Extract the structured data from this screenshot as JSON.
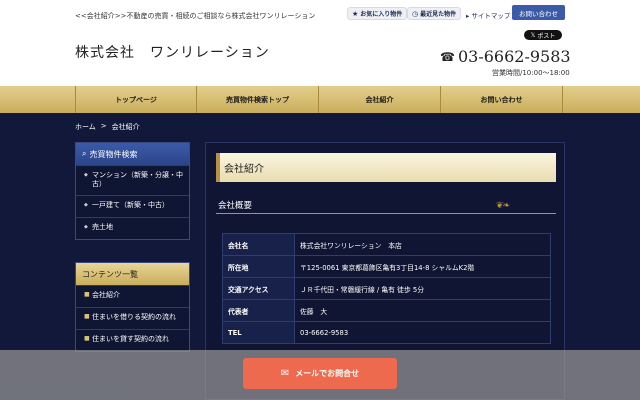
{
  "header": {
    "tagline": "<<会社紹介>>不動産の売買・相続のご相談なら株式会社ワンリレーション",
    "logo": "株式会社　ワンリレーション",
    "favorites": {
      "icon": "star-icon",
      "label": "お気に入り物件"
    },
    "history": {
      "icon": "history-icon",
      "label": "最近見た物件"
    },
    "sitemap": "サイトマップ",
    "contact": "お問い合わせ",
    "x_post": {
      "icon": "x-logo-icon",
      "label": "ポスト"
    },
    "phone": {
      "icon": "phone-icon",
      "number": "03-6662-9583"
    },
    "hours": "営業時間/10:00〜18:00"
  },
  "nav": [
    "トップページ",
    "売買物件検索トップ",
    "会社紹介",
    "お問い合わせ"
  ],
  "breadcrumb": {
    "home": "ホーム",
    "sep": ">",
    "current": "会社紹介"
  },
  "sidebar": {
    "search": {
      "icon": "search-icon",
      "title": "売買物件検索",
      "items": [
        "マンション（新築・分譲・中古）",
        "一戸建て（新築・中古）",
        "売土地"
      ]
    },
    "contents": {
      "title": "コンテンツ一覧",
      "items": [
        "会社紹介",
        "住まいを借りる契約の流れ",
        "住まいを貸す契約の流れ"
      ]
    }
  },
  "main": {
    "title": "会社紹介",
    "section": "会社概要",
    "rows": [
      {
        "label": "会社名",
        "value": "株式会社ワンリレーション　本店"
      },
      {
        "label": "所在地",
        "value": "〒125-0061 東京都葛飾区亀有3丁目14-8 シャルムK2階"
      },
      {
        "label": "交通アクセス",
        "value": "ＪＲ千代田・常磐緩行線 / 亀有 徒歩 5分"
      },
      {
        "label": "代表者",
        "value": "佐藤　大"
      },
      {
        "label": "TEL",
        "value": "03-6662-9583"
      }
    ]
  },
  "footer": {
    "icon": "mail-icon",
    "label": "メールでお問合せ"
  },
  "colors": {
    "navy": "#12183a",
    "gold": "#c9ad5b",
    "accent_blue": "#3b5aa8",
    "cta": "#ed6a4e"
  }
}
